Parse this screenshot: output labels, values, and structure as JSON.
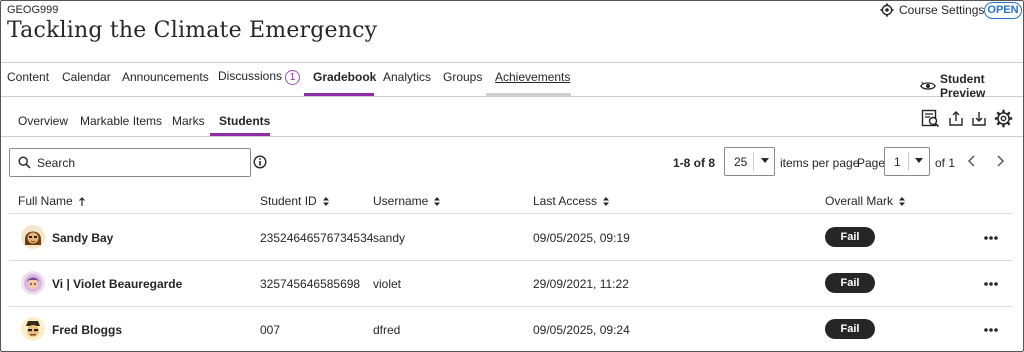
{
  "header": {
    "course_code": "GEOG999",
    "course_title": "Tackling the Climate Emergency",
    "settings_label": "Course Settings",
    "status_badge": "OPEN"
  },
  "nav": {
    "items": [
      {
        "label": "Content"
      },
      {
        "label": "Calendar"
      },
      {
        "label": "Announcements"
      },
      {
        "label": "Discussions",
        "badge": "1"
      },
      {
        "label": "Gradebook"
      },
      {
        "label": "Analytics"
      },
      {
        "label": "Groups"
      },
      {
        "label": "Achievements"
      }
    ],
    "student_preview_label": "Student Preview"
  },
  "subnav": {
    "items": [
      {
        "label": "Overview"
      },
      {
        "label": "Markable Items"
      },
      {
        "label": "Marks"
      },
      {
        "label": "Students"
      }
    ]
  },
  "search": {
    "placeholder": "Search"
  },
  "pagination": {
    "count_label": "1-8 of 8",
    "per_page_value": "25",
    "per_page_label": "items per page",
    "page_label": "Page",
    "page_value": "1",
    "of_label": "of 1"
  },
  "table": {
    "columns": [
      {
        "label": "Full Name"
      },
      {
        "label": "Student ID"
      },
      {
        "label": "Username"
      },
      {
        "label": "Last Access"
      },
      {
        "label": "Overall Mark"
      }
    ],
    "rows": [
      {
        "name": "Sandy Bay",
        "student_id": "23524646576734534",
        "username": "sandy",
        "last_access": "09/05/2025, 09:19",
        "mark": "Fail",
        "avatar": "avatar-sandy-icon"
      },
      {
        "name": "Vi | Violet Beauregarde",
        "student_id": "325745646585698",
        "username": "violet",
        "last_access": "29/09/2021, 11:22",
        "mark": "Fail",
        "avatar": "avatar-violet-icon"
      },
      {
        "name": "Fred Bloggs",
        "student_id": "007",
        "username": "dfred",
        "last_access": "09/05/2025, 09:24",
        "mark": "Fail",
        "avatar": "avatar-fred-icon"
      }
    ]
  },
  "colors": {
    "accent": "#8c2fa6",
    "badge_blue": "#2773c8",
    "fail_pill": "#262626"
  }
}
